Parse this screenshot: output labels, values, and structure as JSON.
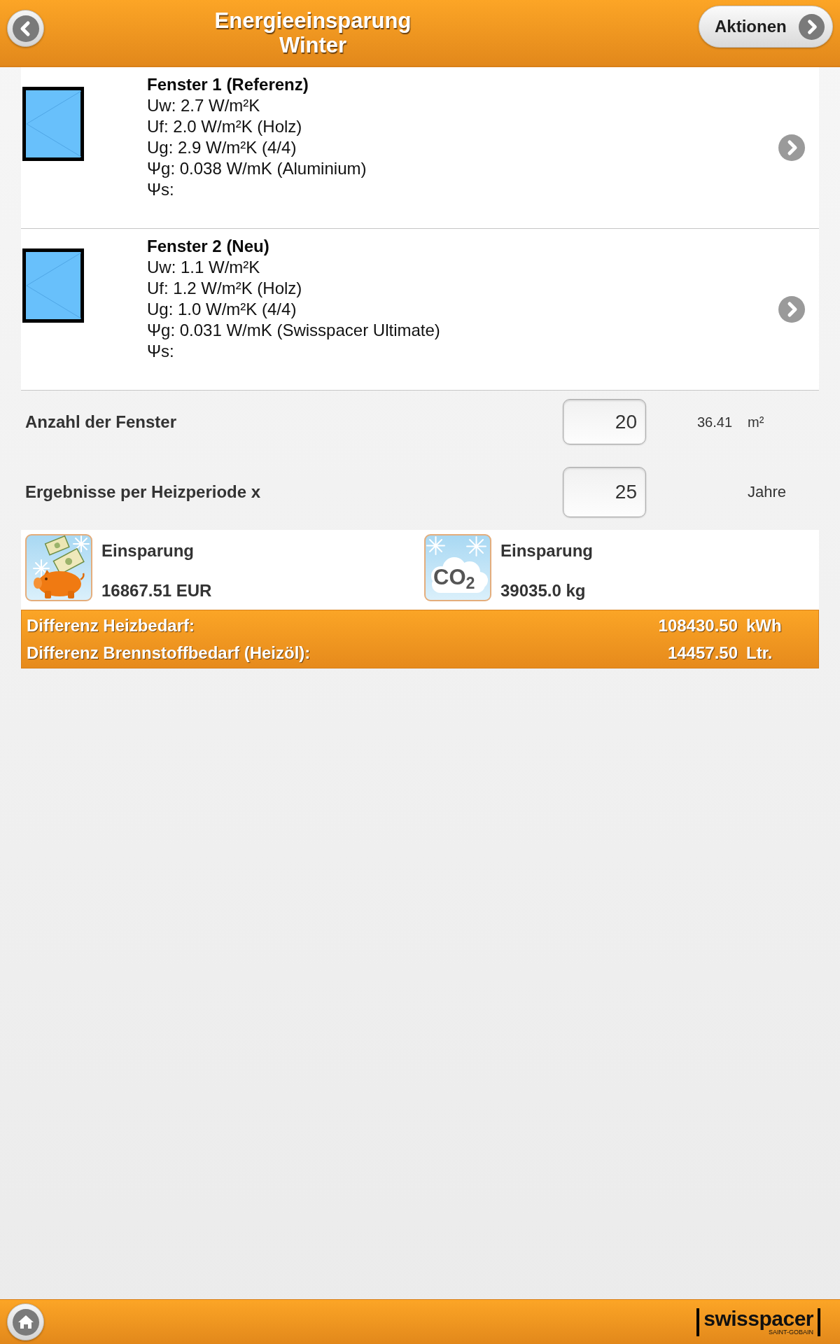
{
  "header": {
    "title": "Energieeinsparung Winter",
    "action_button": "Aktionen"
  },
  "windows": [
    {
      "title": "Fenster 1 (Referenz)",
      "lines": [
        "Uw: 2.7 W/m²K",
        "Uf: 2.0 W/m²K (Holz)",
        "Ug: 2.9 W/m²K (4/4)",
        "Ψg: 0.038 W/mK (Aluminium)",
        "Ψs:"
      ]
    },
    {
      "title": "Fenster 2 (Neu)",
      "lines": [
        "Uw: 1.1 W/m²K",
        "Uf: 1.2 W/m²K (Holz)",
        "Ug: 1.0 W/m²K (4/4)",
        "Ψg: 0.031 W/mK (Swisspacer Ultimate)",
        "Ψs:"
      ]
    }
  ],
  "inputs": [
    {
      "label": "Anzahl der Fenster",
      "value": "20",
      "reading": "36.41",
      "unit": "m²"
    },
    {
      "label": "Ergebnisse per Heizperiode x",
      "value": "25",
      "unit": "Jahre"
    }
  ],
  "savings": [
    {
      "kind": "money",
      "label": "Einsparung",
      "value": "16867.51 EUR"
    },
    {
      "kind": "co2",
      "icon_text": "CO$_{2}$",
      "label": "Einsparung",
      "value": "39035.0 kg"
    }
  ],
  "differences": [
    {
      "label": "Differenz Heizbedarf:",
      "value": "108430.50",
      "unit": "kWh"
    },
    {
      "label": "Differenz Brennstoffbedarf (Heizöl):",
      "value": "14457.50",
      "unit": "Ltr."
    }
  ],
  "footer": {
    "logo": "swisspacer",
    "logo_sub": "SAINT-GOBAIN"
  }
}
